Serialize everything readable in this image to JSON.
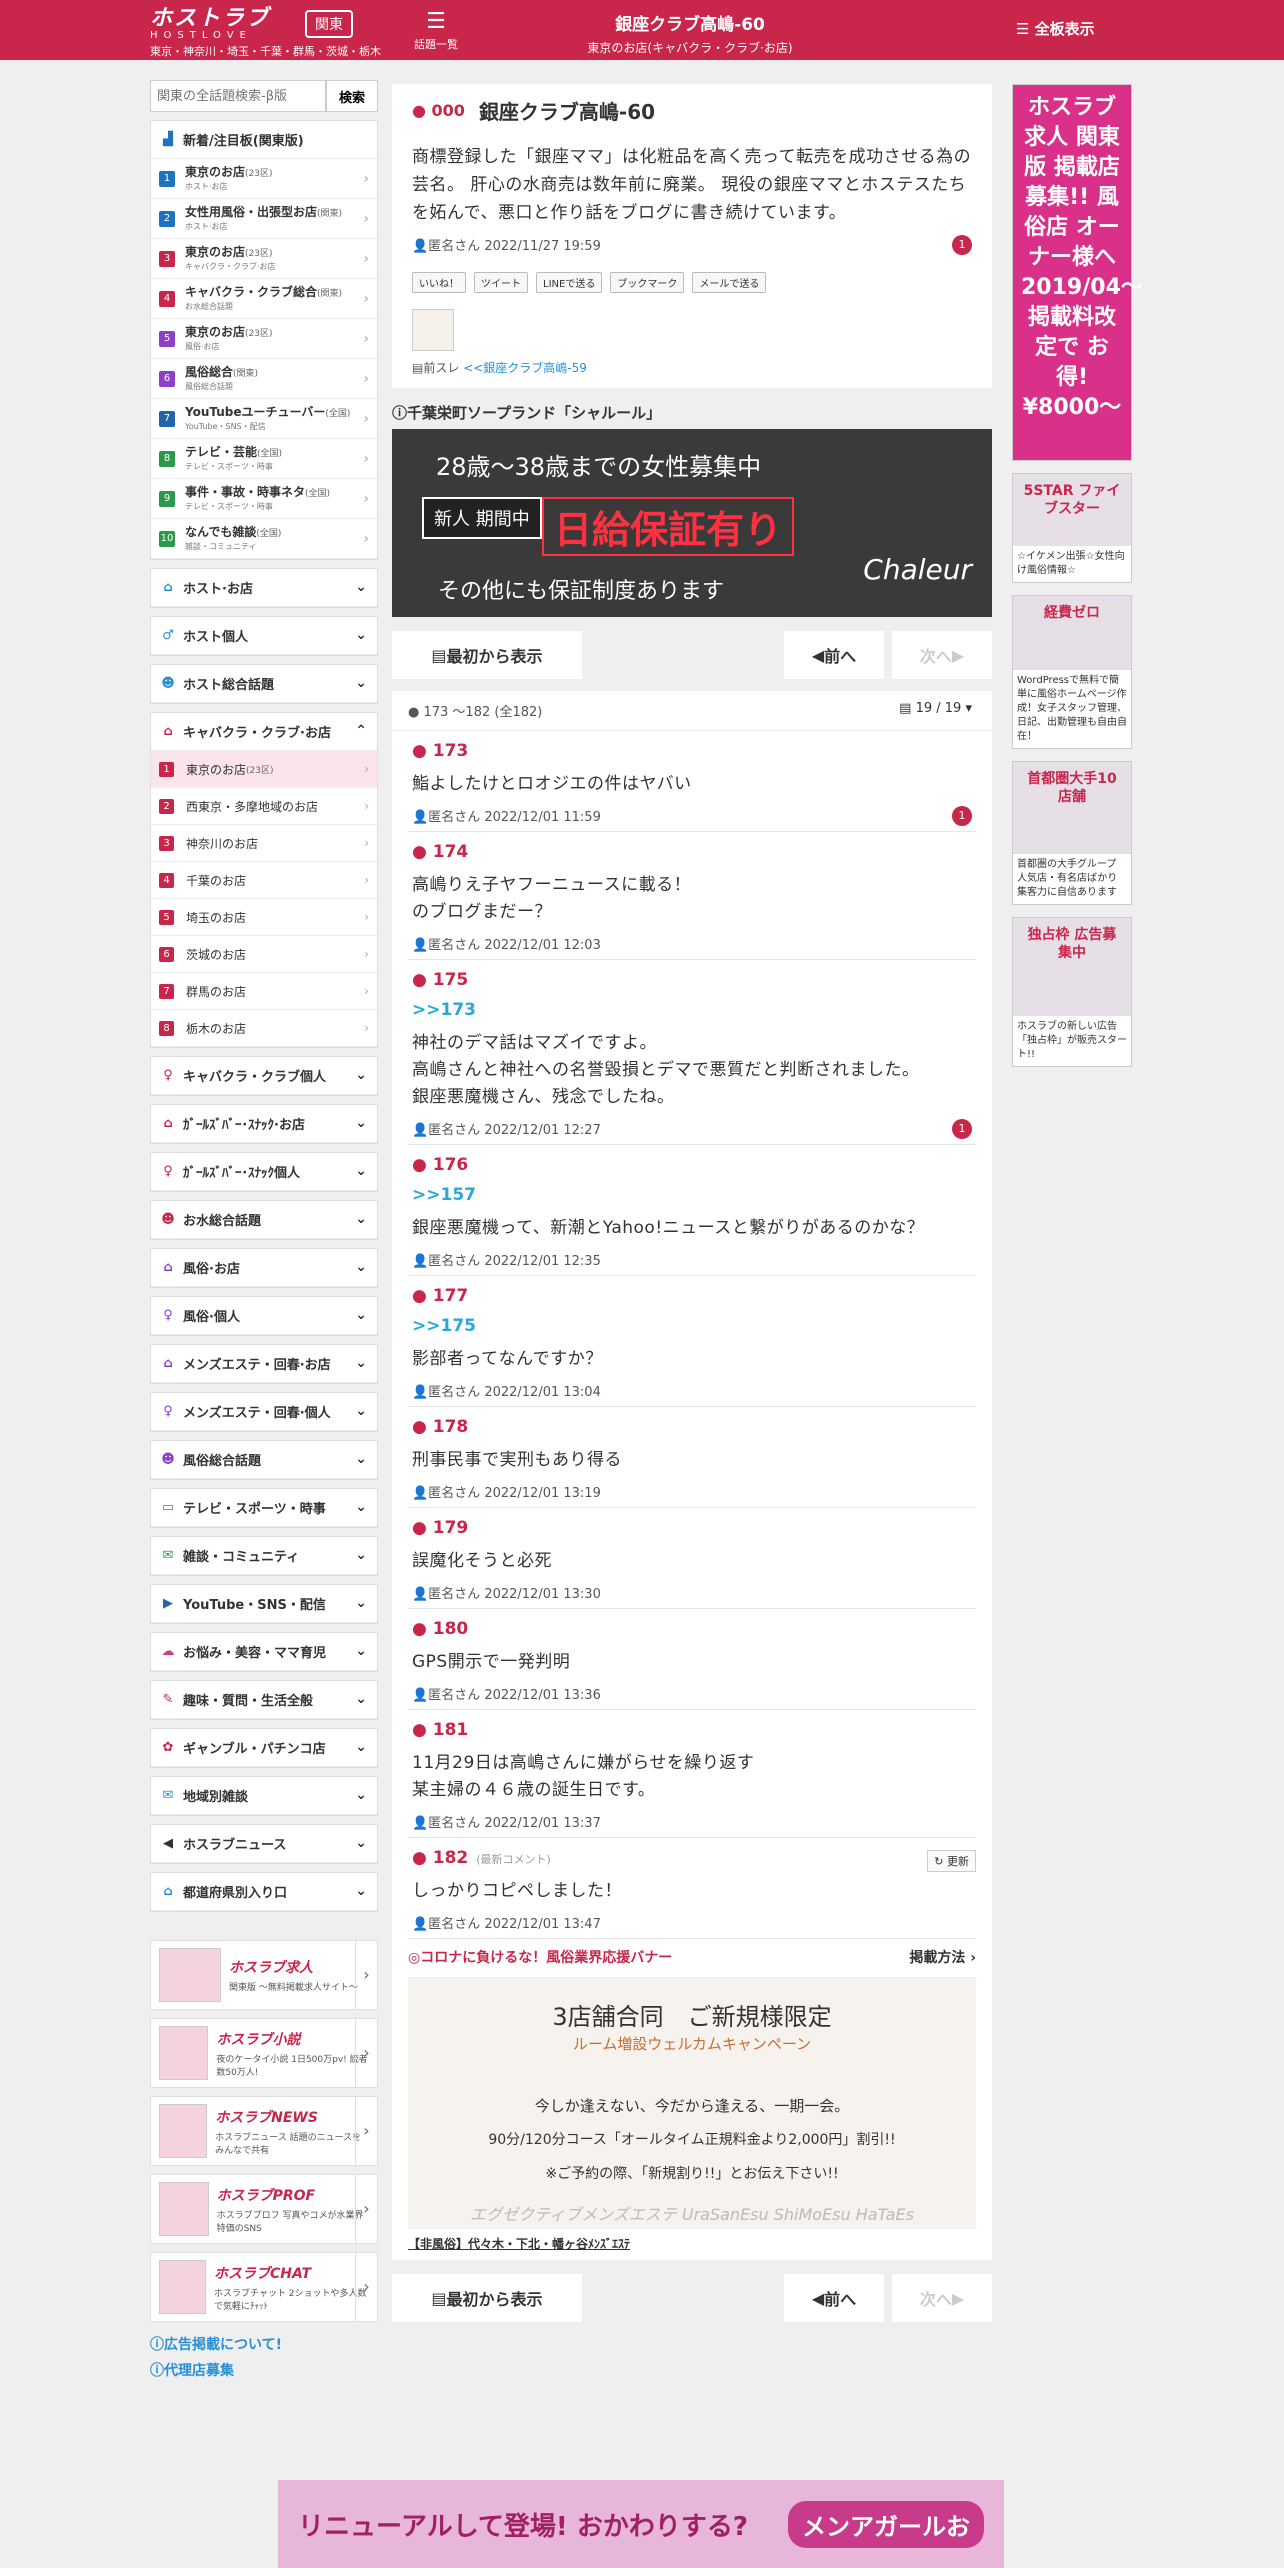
{
  "header": {
    "logo_text": "ホストラブ",
    "logo_sub": "HOSTLOVE",
    "region": "関東",
    "cities": "東京・神奈川・埼玉・千葉・群馬・茨城・栃木",
    "topics_label": "話題一覧",
    "title": "銀座クラブ高嶋-60",
    "subtitle": "東京のお店(キャバクラ・クラブ·お店)",
    "all_display": "全板表示"
  },
  "search": {
    "placeholder": "関東の全話題検索-β版",
    "button": "検索"
  },
  "rank_panel": {
    "title": "新着/注目板(関東版)",
    "items": [
      {
        "n": "1",
        "c": "#1e73be",
        "t": "東京のお店",
        "s": "(23区)",
        "sub": "ホスト·お店"
      },
      {
        "n": "2",
        "c": "#1e73be",
        "t": "女性用風俗・出張型お店",
        "s": "(関東)",
        "sub": "ホスト·お店"
      },
      {
        "n": "3",
        "c": "#c8264a",
        "t": "東京のお店",
        "s": "(23区)",
        "sub": "キャバクラ・クラブ·お店"
      },
      {
        "n": "4",
        "c": "#c8264a",
        "t": "キャバクラ・クラブ総合",
        "s": "(関東)",
        "sub": "お水総合話題"
      },
      {
        "n": "5",
        "c": "#8e3fc8",
        "t": "東京のお店",
        "s": "(23区)",
        "sub": "風俗·お店"
      },
      {
        "n": "6",
        "c": "#8e3fc8",
        "t": "風俗総合",
        "s": "(関東)",
        "sub": "風俗総合話題"
      },
      {
        "n": "7",
        "c": "#2266aa",
        "t": "YouTubeユーチューバー",
        "s": "(全国)",
        "sub": "YouTube・SNS・配信"
      },
      {
        "n": "8",
        "c": "#2a9a4a",
        "t": "テレビ・芸能",
        "s": "(全国)",
        "sub": "テレビ・スポーツ・時事"
      },
      {
        "n": "9",
        "c": "#2a9a4a",
        "t": "事件・事故・時事ネタ",
        "s": "(全国)",
        "sub": "テレビ・スポーツ・時事"
      },
      {
        "n": "10",
        "c": "#2a9a4a",
        "t": "なんでも雑談",
        "s": "(全国)",
        "sub": "雑談・コミュニティ"
      }
    ]
  },
  "categories": {
    "host_shop": "ホスト·お店",
    "host_person": "ホスト個人",
    "host_general": "ホスト総合話題",
    "cabaret_shop": "キャバクラ・クラブ·お店",
    "cabaret_items": [
      {
        "n": "1",
        "t": "東京のお店",
        "s": "(23区)"
      },
      {
        "n": "2",
        "t": "西東京・多摩地域のお店",
        "s": ""
      },
      {
        "n": "3",
        "t": "神奈川のお店",
        "s": ""
      },
      {
        "n": "4",
        "t": "千葉のお店",
        "s": ""
      },
      {
        "n": "5",
        "t": "埼玉のお店",
        "s": ""
      },
      {
        "n": "6",
        "t": "茨城のお店",
        "s": ""
      },
      {
        "n": "7",
        "t": "群馬のお店",
        "s": ""
      },
      {
        "n": "8",
        "t": "栃木のお店",
        "s": ""
      }
    ],
    "rest": [
      {
        "t": "キャバクラ・クラブ個人",
        "ic": "♀",
        "c": "#c8264a"
      },
      {
        "t": "ｶﾞｰﾙｽﾞﾊﾞｰ･ｽﾅｯｸ·お店",
        "ic": "⌂",
        "c": "#c8264a"
      },
      {
        "t": "ｶﾞｰﾙｽﾞﾊﾞｰ･ｽﾅｯｸ個人",
        "ic": "♀",
        "c": "#c8264a"
      },
      {
        "t": "お水総合話題",
        "ic": "☻",
        "c": "#c8264a"
      },
      {
        "t": "風俗·お店",
        "ic": "⌂",
        "c": "#8e3fc8"
      },
      {
        "t": "風俗·個人",
        "ic": "♀",
        "c": "#8e3fc8"
      },
      {
        "t": "メンズエステ・回春·お店",
        "ic": "⌂",
        "c": "#8e3fc8"
      },
      {
        "t": "メンズエステ・回春·個人",
        "ic": "♀",
        "c": "#8e3fc8"
      },
      {
        "t": "風俗総合話題",
        "ic": "☻",
        "c": "#8e3fc8"
      },
      {
        "t": "テレビ・スポーツ・時事",
        "ic": "▭",
        "c": "#2a9a4a"
      },
      {
        "t": "雑談・コミュニティ",
        "ic": "✉",
        "c": "#2a9a4a"
      },
      {
        "t": "YouTube・SNS・配信",
        "ic": "▶",
        "c": "#2266aa"
      },
      {
        "t": "お悩み・美容・ママ育児",
        "ic": "☁",
        "c": "#c83a8a"
      },
      {
        "t": "趣味・質問・生活全般",
        "ic": "✎",
        "c": "#c8264a"
      },
      {
        "t": "ギャンブル・パチンコ店",
        "ic": "✿",
        "c": "#c8264a"
      },
      {
        "t": "地域別雑談",
        "ic": "✉",
        "c": "#2a8fd6"
      },
      {
        "t": "ホスラブニュース",
        "ic": "◀",
        "c": "#333"
      },
      {
        "t": "都道府県別入り口",
        "ic": "⌂",
        "c": "#2a8fd6"
      }
    ]
  },
  "left_banners": [
    {
      "t": "ホスラブ求人",
      "s": "関東版 〜無料掲載求人サイト〜"
    },
    {
      "t": "ホスラブ小説",
      "s": "夜のケータイ小説 1日500万pv! 読者数50万人!"
    },
    {
      "t": "ホスラブNEWS",
      "s": "ホスラブニュース 話題のニュースをみんなで共有"
    },
    {
      "t": "ホスラブPROF",
      "s": "ホスラブプロフ 写真やコメが水業界特価のSNS"
    },
    {
      "t": "ホスラブCHAT",
      "s": "ホスラブチャット 2ショットや多人数で気軽にﾁｬｯﾄ"
    }
  ],
  "left_links": {
    "ad": "広告掲載について!",
    "agent": "代理店募集"
  },
  "thread": {
    "num": "000",
    "title": "銀座クラブ高嶋-60",
    "body": "商標登録した「銀座ママ」は化粧品を高く売って転売を成功させる為の芸名。 肝心の水商売は数年前に廃業。 現役の銀座ママとホステスたちを妬んで、悪口と作り話をブログに書き続けています。",
    "meta": "匿名さん 2022/11/27 19:59",
    "badge": "1",
    "share": [
      "いいね！",
      "ツイート",
      "LINEで送る",
      "ブックマーク",
      "メールで送る"
    ],
    "prev_label": "前スレ",
    "prev_link": "<<銀座クラブ高嶋-59"
  },
  "ad": {
    "label": "千葉栄町ソープランド「シャルール」",
    "line1": "28歳〜38歳までの女性募集中",
    "line2": "新人 期間中",
    "line3": "日給保証有り",
    "line4": "その他にも保証制度あります",
    "brand": "Chaleur"
  },
  "nav": {
    "first": "最初から表示",
    "prev": "前へ",
    "next": "次へ"
  },
  "range": {
    "text": "173 〜182 (全182)",
    "page": "19 / 19"
  },
  "posts": [
    {
      "n": "173",
      "reply": "",
      "body": "鮨よしたけとロオジエの件はヤバい",
      "meta": "匿名さん 2022/12/01 11:59",
      "badge": "1"
    },
    {
      "n": "174",
      "reply": "",
      "body": "高嶋りえ子ヤフーニュースに載る！\nのブログまだー？",
      "meta": "匿名さん 2022/12/01 12:03",
      "badge": ""
    },
    {
      "n": "175",
      "reply": ">>173",
      "body": "神社のデマ話はマズイですよ。\n高嶋さんと神社への名誉毀損とデマで悪質だと判断されました。\n銀座悪魔機さん、残念でしたね。",
      "meta": "匿名さん 2022/12/01 12:27",
      "badge": "1"
    },
    {
      "n": "176",
      "reply": ">>157",
      "body": "銀座悪魔機って、新潮とYahoo!ニュースと繋がりがあるのかな？",
      "meta": "匿名さん 2022/12/01 12:35",
      "badge": ""
    },
    {
      "n": "177",
      "reply": ">>175",
      "body": "影部者ってなんですか？",
      "meta": "匿名さん 2022/12/01 13:04",
      "badge": ""
    },
    {
      "n": "178",
      "reply": "",
      "body": "刑事民事で実刑もあり得る",
      "meta": "匿名さん 2022/12/01 13:19",
      "badge": ""
    },
    {
      "n": "179",
      "reply": "",
      "body": "誤魔化そうと必死",
      "meta": "匿名さん 2022/12/01 13:30",
      "badge": ""
    },
    {
      "n": "180",
      "reply": "",
      "body": "GPS開示で一発判明",
      "meta": "匿名さん 2022/12/01 13:36",
      "badge": ""
    },
    {
      "n": "181",
      "reply": "",
      "body": "11月29日は高嶋さんに嫌がらせを繰り返す\n某主婦の４６歳の誕生日です。",
      "meta": "匿名さん 2022/12/01 13:37",
      "badge": ""
    },
    {
      "n": "182",
      "reply": "",
      "body": "しっかりコピペしました！",
      "meta": "匿名さん 2022/12/01 13:47",
      "badge": "",
      "latest": "(最新コメント)",
      "update": "更新"
    }
  ],
  "covid": {
    "head": "◎コロナに負けるな！風俗業界応援バナー",
    "how": "掲載方法",
    "c1": "3店舗合同　ご新規様限定",
    "c2": "ルーム増設ウェルカムキャンペーン",
    "c3": "今しか逢えない、今だから逢える、一期一会。",
    "c4": "90分/120分コース「オールタイム正規料金より2,000円」割引!!",
    "c5": "※ご予約の際、「新規割り!!」とお伝え下さい!!",
    "c6": "エグゼクティブメンズエステ UraSanEsu ShiMoEsu HaTaEs",
    "foot": "【非風俗】代々木・下北・幡ヶ谷ﾒﾝｽﾞｴｽﾃ"
  },
  "right": [
    {
      "img": "ホスラブ求人 関東版 掲載店 募集!! 風俗店 オーナー様へ 2019/04〜 掲載料改定で お得!¥8000〜",
      "txt": ""
    },
    {
      "img": "5STAR ファイブスター",
      "txt": "☆イケメン出張☆女性向け風俗情報☆"
    },
    {
      "img": "経費ゼロ",
      "txt": "WordPressで無料で簡単に風俗ホームページ作成！女子スタッフ管理、日記、出勤管理も自由自在！"
    },
    {
      "img": "首都圏大手10店舗",
      "txt": "首都圏の大手グループ 人気店・有名店ばかり 集客力に自信あります"
    },
    {
      "img": "独占枠 広告募集中",
      "txt": "ホスラブの新しい広告「独占枠」が販売スタート!!"
    }
  ],
  "bottom_ad": {
    "left": "リニューアルして登場! おかわりする?",
    "right": "メンアガールお"
  }
}
